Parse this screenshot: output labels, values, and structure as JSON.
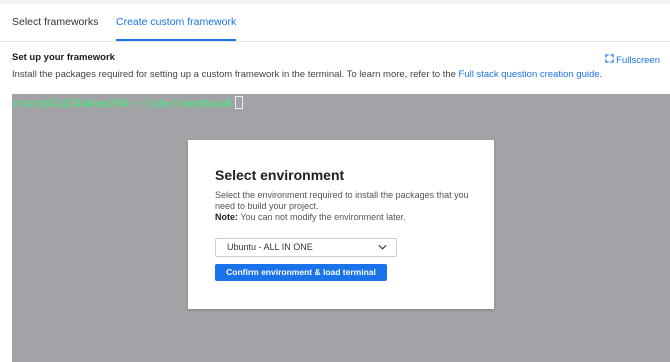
{
  "tabs": [
    {
      "label": "Select frameworks",
      "active": false
    },
    {
      "label": "Create custom framework",
      "active": true
    }
  ],
  "header": {
    "title": "Set up your framework",
    "fullscreen_label": "Fullscreen",
    "description_prefix": "Install the packages required for setting up a custom framework in the terminal. To learn more, refer to the ",
    "description_link": "Full stack question creation guide",
    "description_suffix": "."
  },
  "terminal": {
    "prompt": "root@41d2446ee264:~/ide/sandbox#",
    "prompt_color": "#39f078",
    "background": "#a2a3a6"
  },
  "modal": {
    "title": "Select environment",
    "description": "Select the environment required to install the packages that you need to build your project.",
    "note_label": "Note:",
    "note_text": " You can not modify the environment later.",
    "select_value": "Ubuntu - ALL IN ONE",
    "confirm_label": "Confirm environment & load terminal"
  },
  "colors": {
    "accent": "#1a73e8"
  },
  "icons": {
    "fullscreen": "expand-icon",
    "dropdown": "chevron-down-icon"
  }
}
